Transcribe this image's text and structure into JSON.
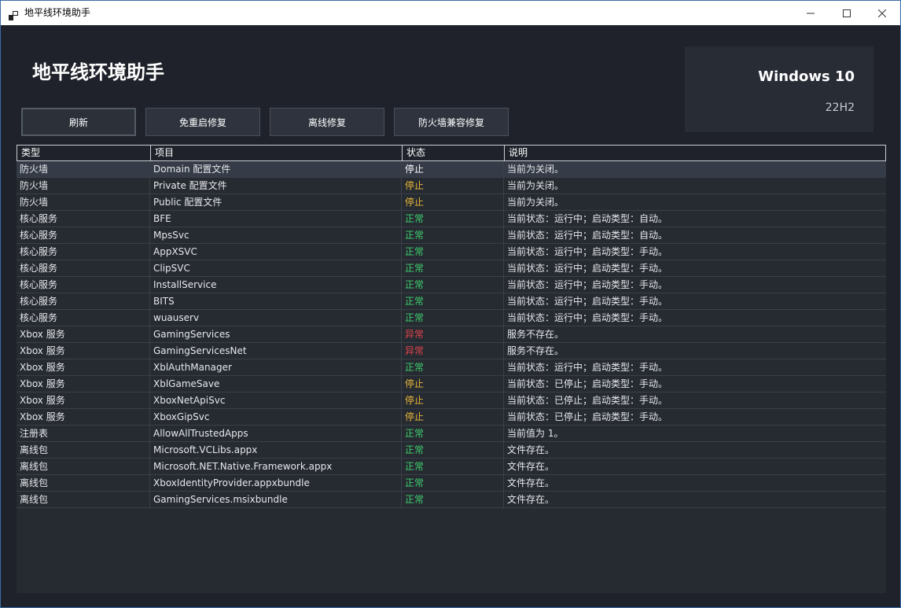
{
  "window": {
    "title": "地平线环境助手"
  },
  "header": {
    "title": "地平线环境助手"
  },
  "system": {
    "name": "Windows 10",
    "version": "22H2"
  },
  "toolbar": {
    "buttons": [
      "刷新",
      "免重启修复",
      "离线修复",
      "防火墙兼容修复"
    ]
  },
  "table": {
    "columns": [
      "类型",
      "项目",
      "状态",
      "说明"
    ],
    "rows": [
      [
        "防火墙",
        "Domain 配置文件",
        "停止",
        "当前为关闭。"
      ],
      [
        "防火墙",
        "Private 配置文件",
        "停止",
        "当前为关闭。"
      ],
      [
        "防火墙",
        "Public 配置文件",
        "停止",
        "当前为关闭。"
      ],
      [
        "核心服务",
        "BFE",
        "正常",
        "当前状态：运行中；启动类型：自动。"
      ],
      [
        "核心服务",
        "MpsSvc",
        "正常",
        "当前状态：运行中；启动类型：自动。"
      ],
      [
        "核心服务",
        "AppXSVC",
        "正常",
        "当前状态：运行中；启动类型：手动。"
      ],
      [
        "核心服务",
        "ClipSVC",
        "正常",
        "当前状态：运行中；启动类型：手动。"
      ],
      [
        "核心服务",
        "InstallService",
        "正常",
        "当前状态：运行中；启动类型：手动。"
      ],
      [
        "核心服务",
        "BITS",
        "正常",
        "当前状态：运行中；启动类型：手动。"
      ],
      [
        "核心服务",
        "wuauserv",
        "正常",
        "当前状态：运行中；启动类型：手动。"
      ],
      [
        "Xbox 服务",
        "GamingServices",
        "异常",
        "服务不存在。"
      ],
      [
        "Xbox 服务",
        "GamingServicesNet",
        "异常",
        "服务不存在。"
      ],
      [
        "Xbox 服务",
        "XblAuthManager",
        "正常",
        "当前状态：运行中；启动类型：手动。"
      ],
      [
        "Xbox 服务",
        "XblGameSave",
        "停止",
        "当前状态：已停止；启动类型：手动。"
      ],
      [
        "Xbox 服务",
        "XboxNetApiSvc",
        "停止",
        "当前状态：已停止；启动类型：手动。"
      ],
      [
        "Xbox 服务",
        "XboxGipSvc",
        "停止",
        "当前状态：已停止；启动类型：手动。"
      ],
      [
        "注册表",
        "AllowAllTrustedApps",
        "正常",
        "当前值为 1。"
      ],
      [
        "离线包",
        "Microsoft.VCLibs.appx",
        "正常",
        "文件存在。"
      ],
      [
        "离线包",
        "Microsoft.NET.Native.Framework.appx",
        "正常",
        "文件存在。"
      ],
      [
        "离线包",
        "XboxIdentityProvider.appxbundle",
        "正常",
        "文件存在。"
      ],
      [
        "离线包",
        "GamingServices.msixbundle",
        "正常",
        "文件存在。"
      ]
    ],
    "selected_row": 0
  },
  "status_colors": {
    "正常": "#3fcf6e",
    "停止": "#e8b83a",
    "异常": "#e0444b",
    "selected": "#ffffff"
  },
  "icons": {
    "app": "app-icon",
    "minimize": "minimize-icon",
    "maximize": "maximize-icon",
    "close": "close-icon"
  }
}
